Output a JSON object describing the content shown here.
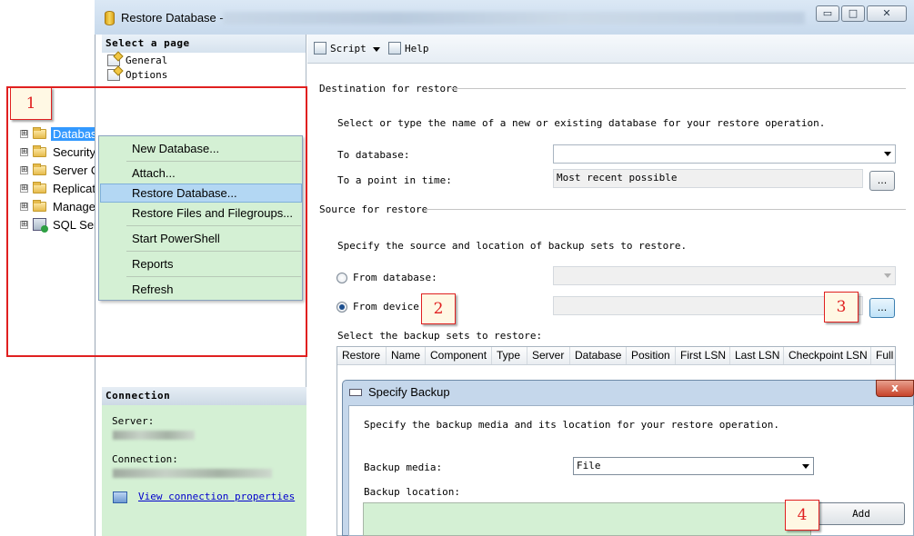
{
  "window": {
    "title": "Restore Database -",
    "controls": {
      "minimize": "▭",
      "maximize": "□",
      "close": "✕"
    }
  },
  "explorer": {
    "items": [
      {
        "label": "Databases",
        "selected": true
      },
      {
        "label": "Security"
      },
      {
        "label": "Server O"
      },
      {
        "label": "Replicati"
      },
      {
        "label": "Manager"
      },
      {
        "label": "SQL Serv"
      }
    ],
    "expander": "⊞"
  },
  "context_menu": {
    "items": [
      "New Database...",
      "Attach...",
      "Restore Database...",
      "Restore Files and Filegroups...",
      "Start PowerShell",
      "Reports",
      "Refresh"
    ],
    "highlighted_index": 2
  },
  "select_page": {
    "header": "Select a page",
    "pages": [
      "General",
      "Options"
    ]
  },
  "connection": {
    "header": "Connection",
    "server_label": "Server:",
    "connection_label": "Connection:",
    "link": "View connection properties"
  },
  "toolbar": {
    "script": "Script",
    "help": "Help"
  },
  "destination": {
    "title": "Destination for restore",
    "instructions": "Select or type the name of a new or existing database for your restore operation.",
    "to_database_label": "To database:",
    "to_database_value": "",
    "point_in_time_label": "To a point in time:",
    "point_in_time_value": "Most recent possible",
    "ellipsis": "..."
  },
  "source": {
    "title": "Source for restore",
    "instructions": "Specify the source and location of backup sets to restore.",
    "from_database_label": "From database:",
    "from_device_label": "From device:",
    "from_device_selected": true,
    "ellipsis": "...",
    "backup_sets_label": "Select the backup sets to restore:",
    "columns": [
      "Restore",
      "Name",
      "Component",
      "Type",
      "Server",
      "Database",
      "Position",
      "First LSN",
      "Last LSN",
      "Checkpoint LSN",
      "Full L"
    ]
  },
  "specify_backup": {
    "title": "Specify Backup",
    "close": "x",
    "instructions": "Specify the backup media and its location for your restore operation.",
    "media_label": "Backup media:",
    "media_value": "File",
    "location_label": "Backup location:",
    "add_button": "Add"
  },
  "annotations": [
    "1",
    "2",
    "3",
    "4"
  ],
  "colors": {
    "annotation_red": "#e02020",
    "highlight_green": "#d4f0d4",
    "menu_highlight": "#b3d7f3",
    "tree_selection": "#3399ff"
  }
}
